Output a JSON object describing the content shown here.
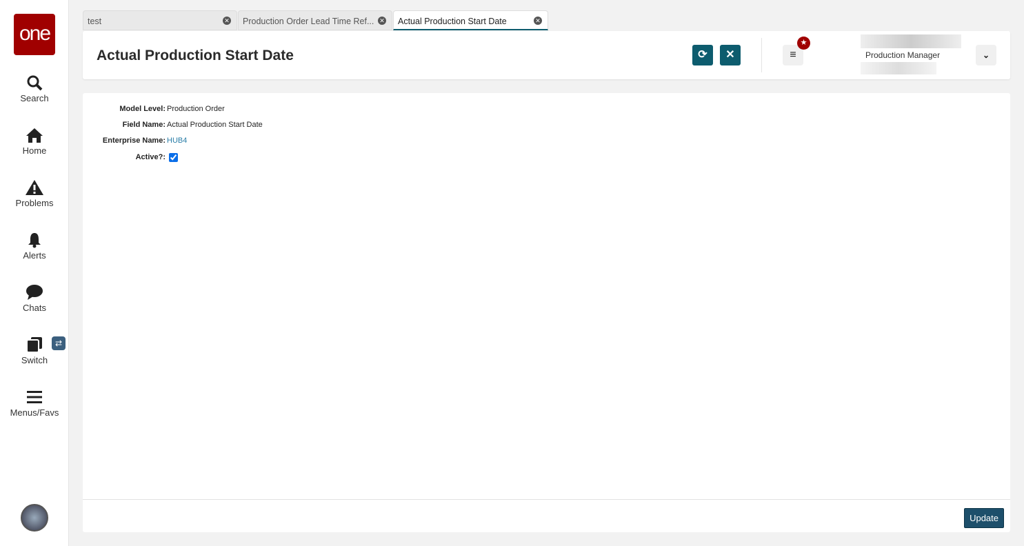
{
  "sidebar": {
    "logo": "one",
    "items": [
      {
        "label": "Search"
      },
      {
        "label": "Home"
      },
      {
        "label": "Problems"
      },
      {
        "label": "Alerts"
      },
      {
        "label": "Chats"
      },
      {
        "label": "Switch"
      },
      {
        "label": "Menus/Favs"
      }
    ]
  },
  "tabs": [
    {
      "label": "test"
    },
    {
      "label": "Production Order Lead Time Ref..."
    },
    {
      "label": "Actual Production Start Date"
    }
  ],
  "header": {
    "title": "Actual Production Start Date",
    "role": "Production Manager"
  },
  "form": {
    "model_level_label": "Model Level:",
    "model_level": "Production Order",
    "field_name_label": "Field Name:",
    "field_name": "Actual Production Start Date",
    "enterprise_label": "Enterprise Name:",
    "enterprise": "HUB4",
    "active_label": "Active?:",
    "active": true
  },
  "footer": {
    "update_label": "Update"
  },
  "colors": {
    "accent": "#0d5c6e",
    "brand": "#a00000",
    "link": "#2a7ea8"
  }
}
